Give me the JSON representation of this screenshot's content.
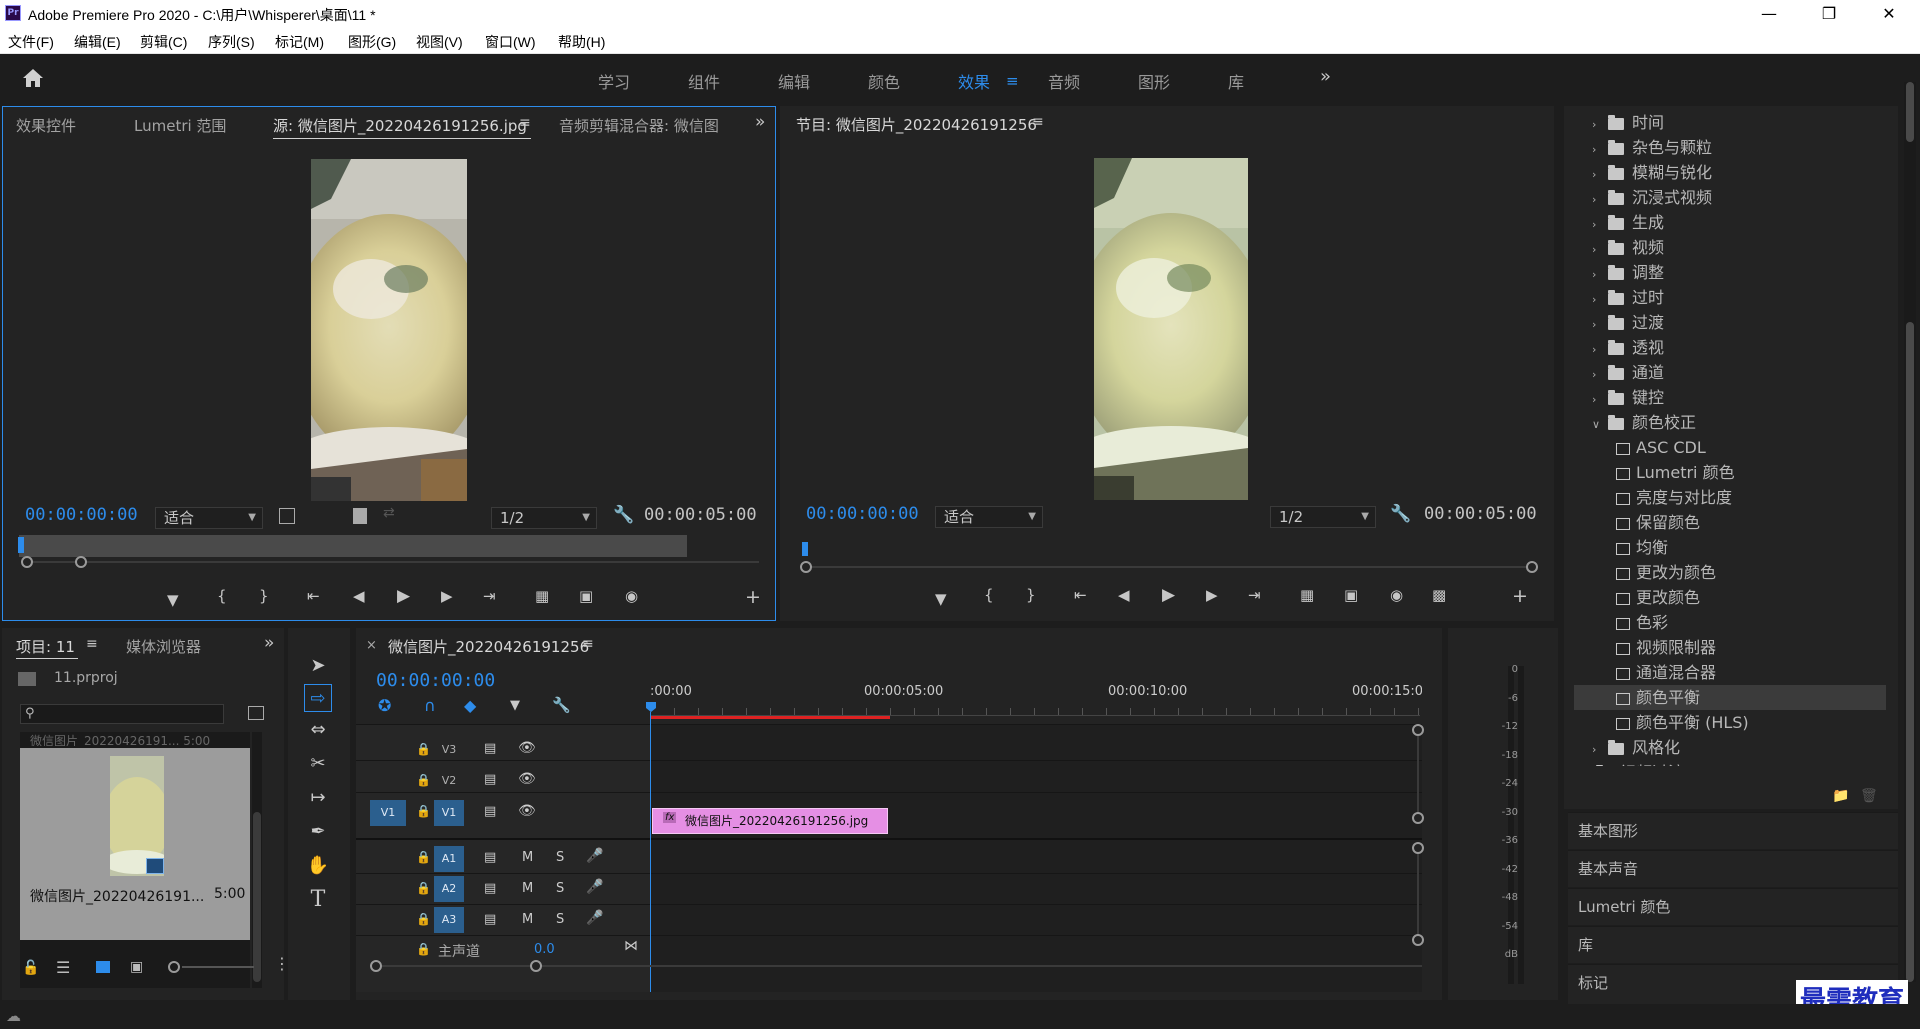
{
  "window": {
    "logo": "Pr",
    "title": "Adobe Premiere Pro 2020 - C:\\用户\\Whisperer\\桌面\\11 *"
  },
  "menu": [
    "文件(F)",
    "编辑(E)",
    "剪辑(C)",
    "序列(S)",
    "标记(M)",
    "图形(G)",
    "视图(V)",
    "窗口(W)",
    "帮助(H)"
  ],
  "workspaces": {
    "tabs": [
      "学习",
      "组件",
      "编辑",
      "颜色",
      "效果",
      "音频",
      "图形",
      "库"
    ],
    "active": "效果"
  },
  "source_panel": {
    "tabs": [
      "效果控件",
      "Lumetri 范围",
      "源: 微信图片_20220426191256.jpg",
      "音频剪辑混合器: 微信图"
    ],
    "timecode": "00:00:00:00",
    "zoom": "适合",
    "resolution": "1/2",
    "duration": "00:00:05:00"
  },
  "program_panel": {
    "title": "节目: 微信图片_20220426191256",
    "timecode": "00:00:00:00",
    "zoom": "适合",
    "resolution": "1/2",
    "duration": "00:00:05:00"
  },
  "effects_panel": {
    "items": [
      {
        "label": "时间",
        "type": "folder",
        "level": 1,
        "expanded": false
      },
      {
        "label": "杂色与颗粒",
        "type": "folder",
        "level": 1,
        "expanded": false
      },
      {
        "label": "模糊与锐化",
        "type": "folder",
        "level": 1,
        "expanded": false
      },
      {
        "label": "沉浸式视频",
        "type": "folder",
        "level": 1,
        "expanded": false
      },
      {
        "label": "生成",
        "type": "folder",
        "level": 1,
        "expanded": false
      },
      {
        "label": "视频",
        "type": "folder",
        "level": 1,
        "expanded": false
      },
      {
        "label": "调整",
        "type": "folder",
        "level": 1,
        "expanded": false
      },
      {
        "label": "过时",
        "type": "folder",
        "level": 1,
        "expanded": false
      },
      {
        "label": "过渡",
        "type": "folder",
        "level": 1,
        "expanded": false
      },
      {
        "label": "透视",
        "type": "folder",
        "level": 1,
        "expanded": false
      },
      {
        "label": "通道",
        "type": "folder",
        "level": 1,
        "expanded": false
      },
      {
        "label": "键控",
        "type": "folder",
        "level": 1,
        "expanded": false
      },
      {
        "label": "颜色校正",
        "type": "folder",
        "level": 1,
        "expanded": true
      },
      {
        "label": "ASC CDL",
        "type": "effect",
        "level": 2
      },
      {
        "label": "Lumetri 颜色",
        "type": "effect",
        "level": 2
      },
      {
        "label": "亮度与对比度",
        "type": "effect",
        "level": 2
      },
      {
        "label": "保留颜色",
        "type": "effect",
        "level": 2
      },
      {
        "label": "均衡",
        "type": "effect",
        "level": 2
      },
      {
        "label": "更改为颜色",
        "type": "effect",
        "level": 2
      },
      {
        "label": "更改颜色",
        "type": "effect",
        "level": 2
      },
      {
        "label": "色彩",
        "type": "effect",
        "level": 2
      },
      {
        "label": "视频限制器",
        "type": "effect",
        "level": 2
      },
      {
        "label": "通道混合器",
        "type": "effect",
        "level": 2
      },
      {
        "label": "颜色平衡",
        "type": "effect",
        "level": 2,
        "selected": true
      },
      {
        "label": "颜色平衡 (HLS)",
        "type": "effect",
        "level": 2
      },
      {
        "label": "风格化",
        "type": "folder",
        "level": 1,
        "expanded": false
      },
      {
        "label": "视频过渡",
        "type": "folder",
        "level": 0,
        "expanded": false
      }
    ],
    "sections": [
      "基本图形",
      "基本声音",
      "Lumetri 颜色",
      "库",
      "标记"
    ]
  },
  "project_panel": {
    "tabs": [
      "项目: 11",
      "媒体浏览器"
    ],
    "file": "11.prproj",
    "search_placeholder": "",
    "partial_item": "微信图片_20220426191... 5:00",
    "thumbnail_name": "微信图片_20220426191...",
    "thumbnail_duration": "5:00"
  },
  "timeline": {
    "title": "微信图片_20220426191256",
    "timecode": "00:00:00:00",
    "ruler": [
      ":00:00",
      "00:00:05:00",
      "00:00:10:00",
      "00:00:15:0("
    ],
    "video_tracks": [
      "V3",
      "V2",
      "V1"
    ],
    "source_patch": "V1",
    "audio_tracks": [
      "A1",
      "A2",
      "A3"
    ],
    "audio_buttons": [
      "M",
      "S"
    ],
    "master": "主声道",
    "master_value": "0.0",
    "clip": {
      "label": "微信图片_20220426191256.jpg",
      "badge": "fx",
      "color": "#e58fe4"
    }
  },
  "meter": {
    "labels": [
      "0",
      "-6",
      "-12",
      "-18",
      "-24",
      "-30",
      "-36",
      "-42",
      "-48",
      "-54",
      "dB"
    ]
  },
  "watermark": "最需教育"
}
